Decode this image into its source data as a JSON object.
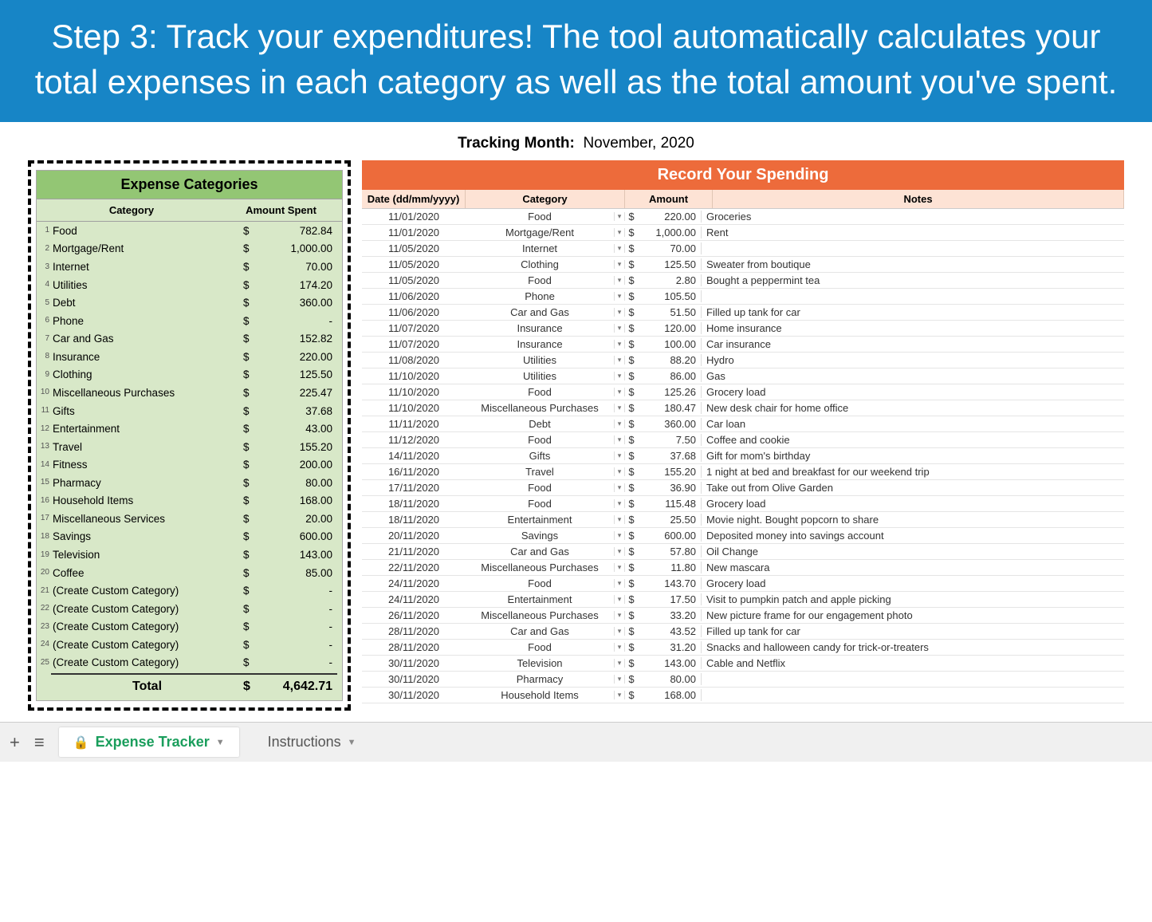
{
  "banner": "Step 3: Track your expenditures! The tool automatically calculates your total expenses in each category as well as the total amount you've spent.",
  "tracking_label": "Tracking Month:",
  "tracking_value": "November, 2020",
  "categories": {
    "title": "Expense Categories",
    "col_category": "Category",
    "col_amount": "Amount Spent",
    "currency": "$",
    "total_label": "Total",
    "total_value": "4,642.71",
    "rows": [
      {
        "i": "1",
        "name": "Food",
        "amt": "782.84"
      },
      {
        "i": "2",
        "name": "Mortgage/Rent",
        "amt": "1,000.00"
      },
      {
        "i": "3",
        "name": "Internet",
        "amt": "70.00"
      },
      {
        "i": "4",
        "name": "Utilities",
        "amt": "174.20"
      },
      {
        "i": "5",
        "name": "Debt",
        "amt": "360.00"
      },
      {
        "i": "6",
        "name": "Phone",
        "amt": "-"
      },
      {
        "i": "7",
        "name": "Car and Gas",
        "amt": "152.82"
      },
      {
        "i": "8",
        "name": "Insurance",
        "amt": "220.00"
      },
      {
        "i": "9",
        "name": "Clothing",
        "amt": "125.50"
      },
      {
        "i": "10",
        "name": "Miscellaneous Purchases",
        "amt": "225.47"
      },
      {
        "i": "11",
        "name": "Gifts",
        "amt": "37.68"
      },
      {
        "i": "12",
        "name": "Entertainment",
        "amt": "43.00"
      },
      {
        "i": "13",
        "name": "Travel",
        "amt": "155.20"
      },
      {
        "i": "14",
        "name": "Fitness",
        "amt": "200.00"
      },
      {
        "i": "15",
        "name": "Pharmacy",
        "amt": "80.00"
      },
      {
        "i": "16",
        "name": "Household Items",
        "amt": "168.00"
      },
      {
        "i": "17",
        "name": "Miscellaneous Services",
        "amt": "20.00"
      },
      {
        "i": "18",
        "name": "Savings",
        "amt": "600.00"
      },
      {
        "i": "19",
        "name": "Television",
        "amt": "143.00"
      },
      {
        "i": "20",
        "name": "Coffee",
        "amt": "85.00"
      },
      {
        "i": "21",
        "name": "(Create Custom Category)",
        "amt": "-"
      },
      {
        "i": "22",
        "name": "(Create Custom Category)",
        "amt": "-"
      },
      {
        "i": "23",
        "name": "(Create Custom Category)",
        "amt": "-"
      },
      {
        "i": "24",
        "name": "(Create Custom Category)",
        "amt": "-"
      },
      {
        "i": "25",
        "name": "(Create Custom Category)",
        "amt": "-"
      }
    ]
  },
  "spending": {
    "title": "Record Your Spending",
    "col_date": "Date (dd/mm/yyyy)",
    "col_category": "Category",
    "col_amount": "Amount",
    "col_notes": "Notes",
    "currency": "$",
    "rows": [
      {
        "d": "11/01/2020",
        "c": "Food",
        "a": "220.00",
        "n": "Groceries"
      },
      {
        "d": "11/01/2020",
        "c": "Mortgage/Rent",
        "a": "1,000.00",
        "n": "Rent"
      },
      {
        "d": "11/05/2020",
        "c": "Internet",
        "a": "70.00",
        "n": ""
      },
      {
        "d": "11/05/2020",
        "c": "Clothing",
        "a": "125.50",
        "n": "Sweater from boutique"
      },
      {
        "d": "11/05/2020",
        "c": "Food",
        "a": "2.80",
        "n": "Bought a peppermint tea"
      },
      {
        "d": "11/06/2020",
        "c": "Phone",
        "a": "105.50",
        "n": ""
      },
      {
        "d": "11/06/2020",
        "c": "Car and Gas",
        "a": "51.50",
        "n": "Filled up tank for car"
      },
      {
        "d": "11/07/2020",
        "c": "Insurance",
        "a": "120.00",
        "n": "Home insurance"
      },
      {
        "d": "11/07/2020",
        "c": "Insurance",
        "a": "100.00",
        "n": "Car insurance"
      },
      {
        "d": "11/08/2020",
        "c": "Utilities",
        "a": "88.20",
        "n": "Hydro"
      },
      {
        "d": "11/10/2020",
        "c": "Utilities",
        "a": "86.00",
        "n": "Gas"
      },
      {
        "d": "11/10/2020",
        "c": "Food",
        "a": "125.26",
        "n": "Grocery load"
      },
      {
        "d": "11/10/2020",
        "c": "Miscellaneous Purchases",
        "a": "180.47",
        "n": "New desk chair for home office"
      },
      {
        "d": "11/11/2020",
        "c": "Debt",
        "a": "360.00",
        "n": "Car loan"
      },
      {
        "d": "11/12/2020",
        "c": "Food",
        "a": "7.50",
        "n": "Coffee and cookie"
      },
      {
        "d": "14/11/2020",
        "c": "Gifts",
        "a": "37.68",
        "n": "Gift for mom's birthday"
      },
      {
        "d": "16/11/2020",
        "c": "Travel",
        "a": "155.20",
        "n": "1 night at bed and breakfast for our weekend trip"
      },
      {
        "d": "17/11/2020",
        "c": "Food",
        "a": "36.90",
        "n": "Take out from Olive Garden"
      },
      {
        "d": "18/11/2020",
        "c": "Food",
        "a": "115.48",
        "n": "Grocery load"
      },
      {
        "d": "18/11/2020",
        "c": "Entertainment",
        "a": "25.50",
        "n": "Movie night. Bought popcorn to share"
      },
      {
        "d": "20/11/2020",
        "c": "Savings",
        "a": "600.00",
        "n": "Deposited money into savings account"
      },
      {
        "d": "21/11/2020",
        "c": "Car and Gas",
        "a": "57.80",
        "n": "Oil Change"
      },
      {
        "d": "22/11/2020",
        "c": "Miscellaneous Purchases",
        "a": "11.80",
        "n": "New mascara"
      },
      {
        "d": "24/11/2020",
        "c": "Food",
        "a": "143.70",
        "n": "Grocery load"
      },
      {
        "d": "24/11/2020",
        "c": "Entertainment",
        "a": "17.50",
        "n": "Visit to pumpkin patch and apple picking"
      },
      {
        "d": "26/11/2020",
        "c": "Miscellaneous Purchases",
        "a": "33.20",
        "n": "New picture frame for our engagement photo"
      },
      {
        "d": "28/11/2020",
        "c": "Car and Gas",
        "a": "43.52",
        "n": "Filled up tank for car"
      },
      {
        "d": "28/11/2020",
        "c": "Food",
        "a": "31.20",
        "n": "Snacks and halloween candy for trick-or-treaters"
      },
      {
        "d": "30/11/2020",
        "c": "Television",
        "a": "143.00",
        "n": "Cable and Netflix"
      },
      {
        "d": "30/11/2020",
        "c": "Pharmacy",
        "a": "80.00",
        "n": ""
      },
      {
        "d": "30/11/2020",
        "c": "Household Items",
        "a": "168.00",
        "n": ""
      }
    ]
  },
  "tabs": {
    "active": "Expense Tracker",
    "other": "Instructions"
  }
}
